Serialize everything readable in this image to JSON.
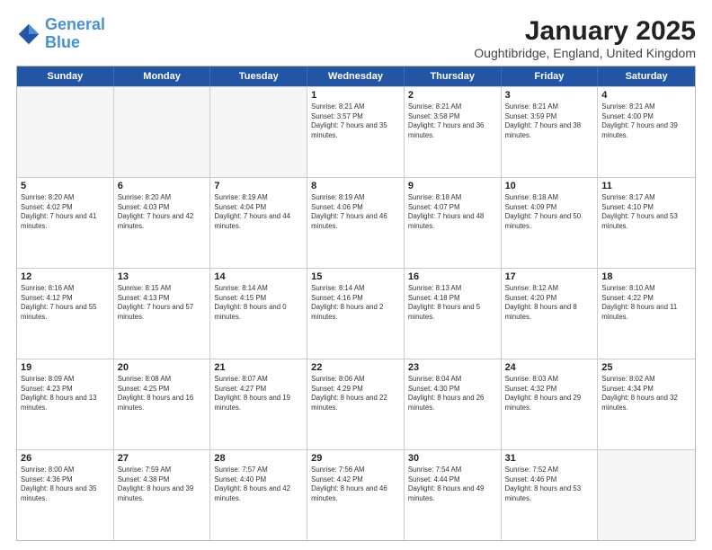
{
  "header": {
    "logo_line1": "General",
    "logo_line2": "Blue",
    "month": "January 2025",
    "location": "Oughtibridge, England, United Kingdom"
  },
  "days_of_week": [
    "Sunday",
    "Monday",
    "Tuesday",
    "Wednesday",
    "Thursday",
    "Friday",
    "Saturday"
  ],
  "weeks": [
    [
      {
        "day": "",
        "empty": true
      },
      {
        "day": "",
        "empty": true
      },
      {
        "day": "",
        "empty": true
      },
      {
        "day": "1",
        "sunrise": "8:21 AM",
        "sunset": "3:57 PM",
        "daylight": "7 hours and 35 minutes."
      },
      {
        "day": "2",
        "sunrise": "8:21 AM",
        "sunset": "3:58 PM",
        "daylight": "7 hours and 36 minutes."
      },
      {
        "day": "3",
        "sunrise": "8:21 AM",
        "sunset": "3:59 PM",
        "daylight": "7 hours and 38 minutes."
      },
      {
        "day": "4",
        "sunrise": "8:21 AM",
        "sunset": "4:00 PM",
        "daylight": "7 hours and 39 minutes."
      }
    ],
    [
      {
        "day": "5",
        "sunrise": "8:20 AM",
        "sunset": "4:02 PM",
        "daylight": "7 hours and 41 minutes."
      },
      {
        "day": "6",
        "sunrise": "8:20 AM",
        "sunset": "4:03 PM",
        "daylight": "7 hours and 42 minutes."
      },
      {
        "day": "7",
        "sunrise": "8:19 AM",
        "sunset": "4:04 PM",
        "daylight": "7 hours and 44 minutes."
      },
      {
        "day": "8",
        "sunrise": "8:19 AM",
        "sunset": "4:06 PM",
        "daylight": "7 hours and 46 minutes."
      },
      {
        "day": "9",
        "sunrise": "8:18 AM",
        "sunset": "4:07 PM",
        "daylight": "7 hours and 48 minutes."
      },
      {
        "day": "10",
        "sunrise": "8:18 AM",
        "sunset": "4:09 PM",
        "daylight": "7 hours and 50 minutes."
      },
      {
        "day": "11",
        "sunrise": "8:17 AM",
        "sunset": "4:10 PM",
        "daylight": "7 hours and 53 minutes."
      }
    ],
    [
      {
        "day": "12",
        "sunrise": "8:16 AM",
        "sunset": "4:12 PM",
        "daylight": "7 hours and 55 minutes."
      },
      {
        "day": "13",
        "sunrise": "8:15 AM",
        "sunset": "4:13 PM",
        "daylight": "7 hours and 57 minutes."
      },
      {
        "day": "14",
        "sunrise": "8:14 AM",
        "sunset": "4:15 PM",
        "daylight": "8 hours and 0 minutes."
      },
      {
        "day": "15",
        "sunrise": "8:14 AM",
        "sunset": "4:16 PM",
        "daylight": "8 hours and 2 minutes."
      },
      {
        "day": "16",
        "sunrise": "8:13 AM",
        "sunset": "4:18 PM",
        "daylight": "8 hours and 5 minutes."
      },
      {
        "day": "17",
        "sunrise": "8:12 AM",
        "sunset": "4:20 PM",
        "daylight": "8 hours and 8 minutes."
      },
      {
        "day": "18",
        "sunrise": "8:10 AM",
        "sunset": "4:22 PM",
        "daylight": "8 hours and 11 minutes."
      }
    ],
    [
      {
        "day": "19",
        "sunrise": "8:09 AM",
        "sunset": "4:23 PM",
        "daylight": "8 hours and 13 minutes."
      },
      {
        "day": "20",
        "sunrise": "8:08 AM",
        "sunset": "4:25 PM",
        "daylight": "8 hours and 16 minutes."
      },
      {
        "day": "21",
        "sunrise": "8:07 AM",
        "sunset": "4:27 PM",
        "daylight": "8 hours and 19 minutes."
      },
      {
        "day": "22",
        "sunrise": "8:06 AM",
        "sunset": "4:29 PM",
        "daylight": "8 hours and 22 minutes."
      },
      {
        "day": "23",
        "sunrise": "8:04 AM",
        "sunset": "4:30 PM",
        "daylight": "8 hours and 26 minutes."
      },
      {
        "day": "24",
        "sunrise": "8:03 AM",
        "sunset": "4:32 PM",
        "daylight": "8 hours and 29 minutes."
      },
      {
        "day": "25",
        "sunrise": "8:02 AM",
        "sunset": "4:34 PM",
        "daylight": "8 hours and 32 minutes."
      }
    ],
    [
      {
        "day": "26",
        "sunrise": "8:00 AM",
        "sunset": "4:36 PM",
        "daylight": "8 hours and 35 minutes."
      },
      {
        "day": "27",
        "sunrise": "7:59 AM",
        "sunset": "4:38 PM",
        "daylight": "8 hours and 39 minutes."
      },
      {
        "day": "28",
        "sunrise": "7:57 AM",
        "sunset": "4:40 PM",
        "daylight": "8 hours and 42 minutes."
      },
      {
        "day": "29",
        "sunrise": "7:56 AM",
        "sunset": "4:42 PM",
        "daylight": "8 hours and 46 minutes."
      },
      {
        "day": "30",
        "sunrise": "7:54 AM",
        "sunset": "4:44 PM",
        "daylight": "8 hours and 49 minutes."
      },
      {
        "day": "31",
        "sunrise": "7:52 AM",
        "sunset": "4:46 PM",
        "daylight": "8 hours and 53 minutes."
      },
      {
        "day": "",
        "empty": true
      }
    ]
  ]
}
